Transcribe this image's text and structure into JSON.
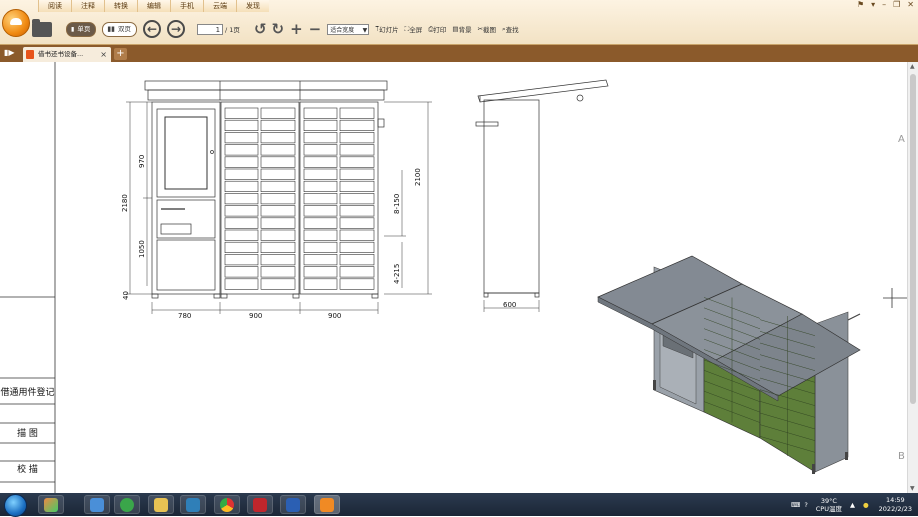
{
  "menu": [
    "阅读",
    "注释",
    "转换",
    "编辑",
    "手机",
    "云端",
    "发现"
  ],
  "toolbar": {
    "single_page": "单页",
    "double_page": "双页",
    "page_current": "1",
    "page_total": "/ 1页",
    "zoom": "适合宽度",
    "slideshow": "幻灯片",
    "fullscreen": "全屏",
    "print": "打印",
    "background": "背景",
    "screenshot": "截图",
    "search": "查找"
  },
  "tab": {
    "title": "借书还书设备..."
  },
  "side_table": [
    "借通用件登记",
    "描  图",
    "校  描"
  ],
  "dimensions": {
    "left_height_total": "2180",
    "left_upper": "970",
    "left_lower": "1050",
    "left_base": "40",
    "width_1": "780",
    "width_2": "900",
    "width_3": "900",
    "right_height": "2100",
    "cell_stack_1": "8-150",
    "cell_stack_2": "4-215",
    "side_depth": "600"
  },
  "taskbar": {
    "temperature": "39°C",
    "cpu_label": "CPU温度",
    "time": "14:59",
    "date": "2022/2/23"
  },
  "colors": {
    "ribbon": "#f2e2c4",
    "tabbar": "#8b5a2b",
    "locker_green": "#5e7f3a",
    "locker_grey": "#8c939c"
  }
}
